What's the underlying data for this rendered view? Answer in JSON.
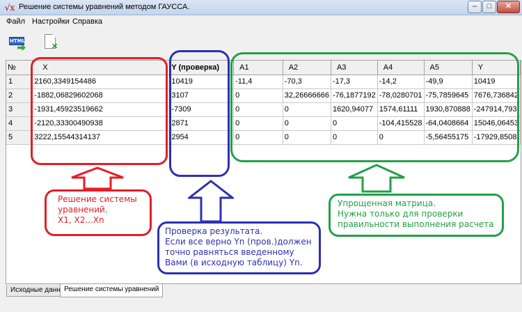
{
  "window": {
    "title": "Решение системы уравнений методом ГАУССА.",
    "min_glyph": "–",
    "max_glyph": "□",
    "close_glyph": "✕"
  },
  "menu": [
    "Файл",
    "Настройки",
    "Справка"
  ],
  "toolbar": {
    "html_icon_text": "HTML"
  },
  "grid": {
    "corner": "№",
    "headers": [
      "X",
      "Y (проверка)",
      "A1",
      "A2",
      "A3",
      "A4",
      "A5",
      "Y"
    ],
    "rows": [
      {
        "n": "1",
        "cells": [
          "2160,3349154486",
          "10419",
          "-11,4",
          "-70,3",
          "-17,3",
          "-14,2",
          "-49,9",
          "10419"
        ]
      },
      {
        "n": "2",
        "cells": [
          "-1882,06829602068",
          "3107",
          "0",
          "32,26666666",
          "-76,1877192",
          "-78,0280701",
          "-75,7859645",
          "7676,736842"
        ]
      },
      {
        "n": "3",
        "cells": [
          "-1931,45923519662",
          "-7309",
          "0",
          "0",
          "1620,94077",
          "1574,61111",
          "1930,870888",
          "-247914,793"
        ]
      },
      {
        "n": "4",
        "cells": [
          "-2120,33300490938",
          "2871",
          "0",
          "0",
          "0",
          "-104,415528",
          "-64,0408664",
          "15046,06453"
        ]
      },
      {
        "n": "5",
        "cells": [
          "3222,15544314137",
          "2954",
          "0",
          "0",
          "0",
          "0",
          "-5,56455175",
          "-17929,8508"
        ]
      }
    ]
  },
  "annotations": {
    "red": [
      "Решение системы",
      "уравнений.",
      "X1, X2...Xn"
    ],
    "blue": [
      "Проверка результата.",
      "Если все верно Yn (пров.)должен",
      "точно равняться введенному",
      "Вами (в исходную таблицу) Yn."
    ],
    "green": [
      "Упрощенная матрица.",
      "Нужна только для проверки",
      "правильности выполнения расчета"
    ]
  },
  "colors": {
    "red": "#e21f26",
    "blue": "#2d2fb3",
    "green": "#23a047"
  },
  "tabs": [
    "Исходные данные",
    "Решение системы уравнений"
  ],
  "active_tab": "Решение системы уравнений"
}
